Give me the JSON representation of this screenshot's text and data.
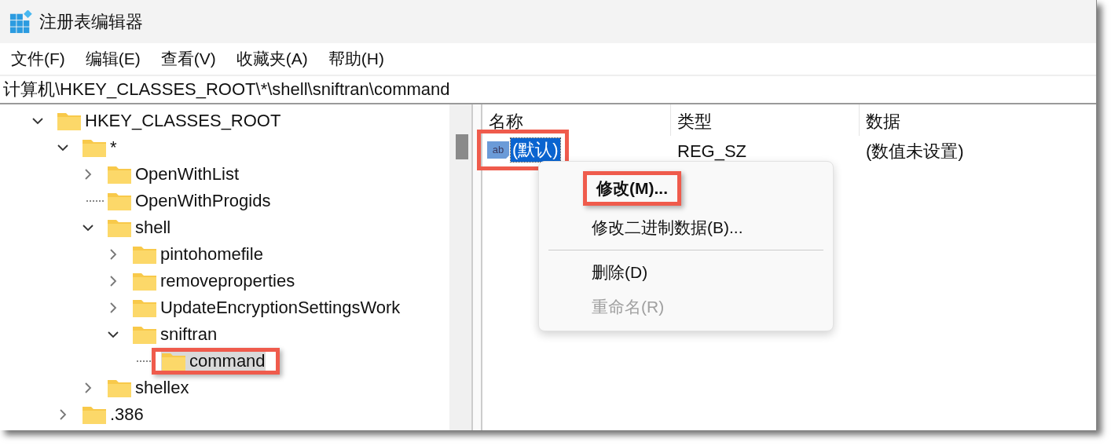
{
  "window": {
    "title": "注册表编辑器"
  },
  "menu_bar": [
    {
      "label": "文件(F)"
    },
    {
      "label": "编辑(E)"
    },
    {
      "label": "查看(V)"
    },
    {
      "label": "收藏夹(A)"
    },
    {
      "label": "帮助(H)"
    }
  ],
  "address_bar": {
    "value": "计算机\\HKEY_CLASSES_ROOT\\*\\shell\\sniftran\\command"
  },
  "tree": [
    {
      "label": "HKEY_CLASSES_ROOT",
      "kind": "branch",
      "expanded": true,
      "selected": false,
      "highlighted": false,
      "children": [
        {
          "label": "*",
          "kind": "branch",
          "expanded": true,
          "selected": false,
          "highlighted": false,
          "children": [
            {
              "label": "OpenWithList",
              "kind": "branch",
              "expanded": false,
              "selected": false,
              "highlighted": false
            },
            {
              "label": "OpenWithProgids",
              "kind": "leaf",
              "selected": false,
              "highlighted": false
            },
            {
              "label": "shell",
              "kind": "branch",
              "expanded": true,
              "selected": false,
              "highlighted": false,
              "children": [
                {
                  "label": "pintohomefile",
                  "kind": "branch",
                  "expanded": false,
                  "selected": false,
                  "highlighted": false
                },
                {
                  "label": "removeproperties",
                  "kind": "branch",
                  "expanded": false,
                  "selected": false,
                  "highlighted": false
                },
                {
                  "label": "UpdateEncryptionSettingsWork",
                  "kind": "branch",
                  "expanded": false,
                  "selected": false,
                  "highlighted": false
                },
                {
                  "label": "sniftran",
                  "kind": "branch",
                  "expanded": true,
                  "selected": false,
                  "highlighted": false,
                  "children": [
                    {
                      "label": "command",
                      "kind": "leaf",
                      "selected": true,
                      "highlighted": true
                    }
                  ]
                }
              ]
            },
            {
              "label": "shellex",
              "kind": "branch",
              "expanded": false,
              "selected": false,
              "highlighted": false
            }
          ]
        },
        {
          "label": ".386",
          "kind": "branch",
          "expanded": false,
          "selected": false,
          "highlighted": false
        }
      ]
    }
  ],
  "values_table": {
    "columns": [
      {
        "label": "名称"
      },
      {
        "label": "类型"
      },
      {
        "label": "数据"
      }
    ],
    "rows": [
      {
        "icon_label": "ab",
        "name": "(默认)",
        "type": "REG_SZ",
        "data": "(数值未设置)",
        "selected": true,
        "highlighted": true
      }
    ]
  },
  "context_menu": [
    {
      "kind": "item",
      "label": "修改(M)...",
      "default": true,
      "disabled": false,
      "highlighted": true
    },
    {
      "kind": "item",
      "label": "修改二进制数据(B)...",
      "default": false,
      "disabled": false,
      "highlighted": false
    },
    {
      "kind": "separator"
    },
    {
      "kind": "item",
      "label": "删除(D)",
      "default": false,
      "disabled": false,
      "highlighted": false
    },
    {
      "kind": "item",
      "label": "重命名(R)",
      "default": false,
      "disabled": true,
      "highlighted": false
    }
  ]
}
